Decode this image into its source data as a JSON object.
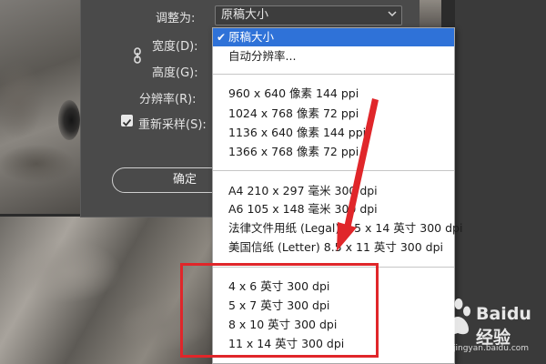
{
  "dialog": {
    "preset_label": "调整为:",
    "preset_value": "原稿大小",
    "width_label": "宽度(D):",
    "height_label": "高度(G):",
    "resolution_label": "分辨率(R):",
    "resample_label": "重新采样(S):",
    "resample_checked": true,
    "ok_label": "确定"
  },
  "menu": {
    "items": [
      {
        "label": "原稿大小",
        "selected": true
      },
      {
        "label": "自动分辨率..."
      },
      {
        "label": "960 x 640 像素 144 ppi"
      },
      {
        "label": "1024 x 768 像素 72 ppi"
      },
      {
        "label": "1136 x 640 像素 144 ppi"
      },
      {
        "label": "1366 x 768 像素 72 ppi"
      },
      {
        "label": "A4 210 x 297 毫米 300 dpi"
      },
      {
        "label": "A6 105 x 148 毫米 300 dpi"
      },
      {
        "label": "法律文件用纸 (Legal) 8.5 x 14 英寸 300 dpi"
      },
      {
        "label": "美国信纸 (Letter) 8.5 x 11 英寸 300 dpi"
      },
      {
        "label": "4 x 6 英寸 300 dpi"
      },
      {
        "label": "5 x 7 英寸 300 dpi"
      },
      {
        "label": "8 x 10 英寸 300 dpi"
      },
      {
        "label": "11 x 14 英寸 300 dpi"
      }
    ]
  },
  "watermark": {
    "brand": "Baidu经验",
    "url": "jingyan.baidu.com"
  },
  "colors": {
    "selection": "#2f72d8",
    "annotation": "#e0262a"
  }
}
